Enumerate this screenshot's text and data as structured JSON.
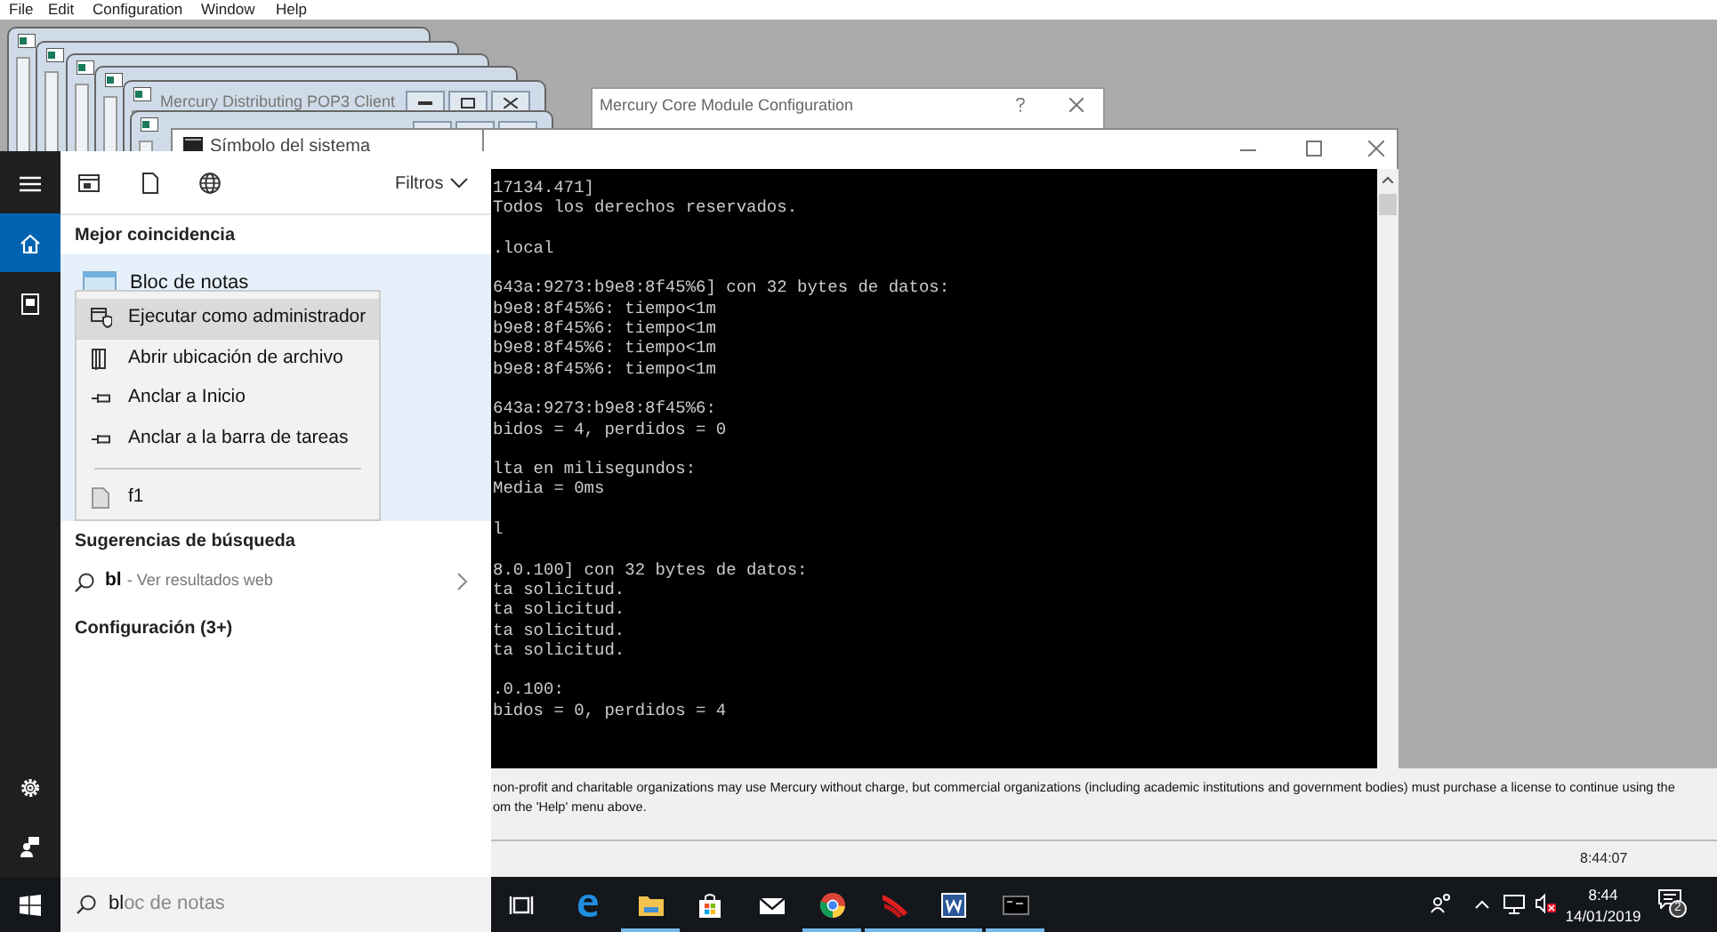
{
  "app_menu": [
    "File",
    "Edit",
    "Configuration",
    "Window",
    "Help"
  ],
  "mdi_windows": [
    {
      "title": "Mercury Distributing POP3 Client"
    },
    {
      "title": "Símbolo del sistema"
    }
  ],
  "dialog": {
    "title": "Mercury Core Module Configuration"
  },
  "console": {
    "blocks": [
      [
        "17134.471]",
        "Todos los derechos reservados."
      ],
      [
        ".local"
      ],
      [
        "643a:9273:b9e8:8f45%6] con 32 bytes de datos:",
        "b9e8:8f45%6: tiempo<1m",
        "b9e8:8f45%6: tiempo<1m",
        "b9e8:8f45%6: tiempo<1m",
        "b9e8:8f45%6: tiempo<1m"
      ],
      [
        "643a:9273:b9e8:8f45%6:",
        "bidos = 4, perdidos = 0"
      ],
      [
        "lta en milisegundos:",
        "Media = 0ms"
      ],
      [
        "l"
      ],
      [
        "8.0.100] con 32 bytes de datos:",
        "ta solicitud.",
        "ta solicitud.",
        "ta solicitud.",
        "ta solicitud."
      ],
      [
        ".0.100:",
        "bidos = 0, perdidos = 4"
      ]
    ]
  },
  "mercury_notice": {
    "lines": [
      "non-profit and charitable organizations may use Mercury without charge, but commercial organizations (including academic institutions and government bodies) must purchase a license to continue using the",
      "om the 'Help' menu above."
    ],
    "status_time": "8:44:07"
  },
  "start_menu": {
    "rail": [
      {
        "kind": "home",
        "selected": true
      },
      {
        "kind": "documents",
        "selected": false
      }
    ],
    "filters_label": "Filtros",
    "best_match_heading": "Mejor coincidencia",
    "best_match": "Bloc de notas",
    "context_menu": [
      {
        "kind": "admin",
        "label": "Ejecutar como administrador",
        "selected": true
      },
      {
        "kind": "folder",
        "label": "Abrir ubicación de archivo",
        "selected": false
      },
      {
        "kind": "pin",
        "label": "Anclar a Inicio",
        "selected": false
      },
      {
        "kind": "pin",
        "label": "Anclar a la barra de tareas",
        "selected": false
      },
      {
        "kind": "file",
        "label": "f1",
        "selected": false
      }
    ],
    "suggestions_heading": "Sugerencias de búsqueda",
    "suggestion": {
      "query": "bl",
      "hint": "- Ver resultados web"
    },
    "settings_heading": "Configuración (3+)",
    "search": {
      "typed": "bl",
      "completion": "oc de notas"
    }
  },
  "taskbar": {
    "apps": [
      {
        "kind": "task-view",
        "running": false
      },
      {
        "kind": "edge",
        "running": false
      },
      {
        "kind": "explorer",
        "running": true
      },
      {
        "kind": "store",
        "running": false
      },
      {
        "kind": "mail",
        "running": false
      },
      {
        "kind": "chrome",
        "running": true
      },
      {
        "kind": "mercury",
        "running": true
      },
      {
        "kind": "word",
        "running": true
      },
      {
        "kind": "console",
        "running": true
      }
    ],
    "clock": {
      "time": "8:44",
      "date": "14/01/2019"
    },
    "notifications": "2"
  }
}
